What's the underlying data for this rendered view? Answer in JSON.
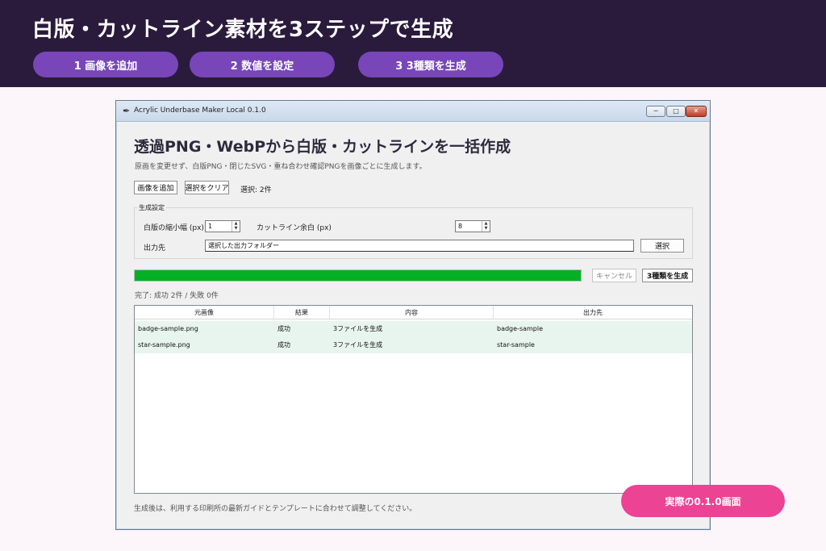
{
  "banner": {
    "title": "白版・カットライン素材を3ステップで生成",
    "steps": [
      "1  画像を追加",
      "2  数値を設定",
      "3  3種類を生成"
    ]
  },
  "window": {
    "title": "Acrylic Underbase Maker Local 0.1.0",
    "controls": {
      "minimize": "─",
      "maximize": "□",
      "close": "✕"
    }
  },
  "app": {
    "heading": "透過PNG・WebPから白版・カットラインを一括作成",
    "subtitle": "原画を変更せず、白版PNG・閉じたSVG・重ね合わせ確認PNGを画像ごとに生成します。",
    "toolbar": {
      "add_label": "画像を追加",
      "clear_label": "選択をクリア",
      "selection": "選択: 2件"
    },
    "settings": {
      "legend": "生成設定",
      "shrink_label": "白版の縮小幅 (px)",
      "shrink_value": "1",
      "margin_label": "カットライン余白 (px)",
      "margin_value": "8",
      "output_label": "出力先",
      "output_value": "選択した出力フォルダー",
      "browse_label": "選択"
    },
    "progress": {
      "value": 1.0
    },
    "cancel_label": "キャンセル",
    "generate_label": "3種類を生成",
    "status": "完了: 成功 2件 / 失敗 0件",
    "table": {
      "columns": [
        "元画像",
        "結果",
        "内容",
        "出力先"
      ],
      "rows": [
        {
          "source": "badge-sample.png",
          "result": "成功",
          "content": "3ファイルを生成",
          "output": "badge-sample"
        },
        {
          "source": "star-sample.png",
          "result": "成功",
          "content": "3ファイルを生成",
          "output": "star-sample"
        }
      ]
    },
    "footer_note": "生成後は、利用する印刷所の最新ガイドとテンプレートに合わせて調整してください。"
  },
  "badge": "実際の0.1.0画面",
  "colors": {
    "banner_bg": "#2a1b3d",
    "step_bg": "#7846b8",
    "progress_fill": "#06b025",
    "row_bg": "#e8f5ee",
    "badge_bg": "#ec4394"
  }
}
